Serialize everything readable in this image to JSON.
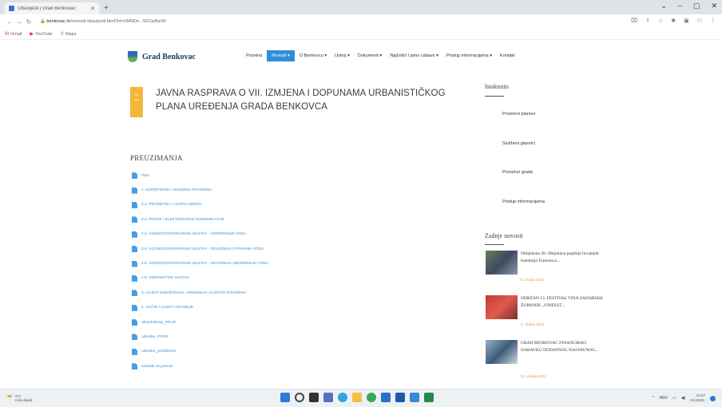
{
  "browser": {
    "tab_title": "Obavijesti | Grad Benkovac",
    "new_tab": "+",
    "win_min": "–",
    "win_max": "▢",
    "win_close": "✕",
    "url_domain": "benkovac.hr",
    "url_rest": "/novosti-obavijesti.html?id=UMNDe...SFCwBaXR",
    "bookmarks": [
      "Gmail",
      "YouTube",
      "Maps"
    ]
  },
  "site": {
    "logo": "Grad Benkovac",
    "nav": [
      {
        "label": "Početna",
        "active": false
      },
      {
        "label": "Novosti ▾",
        "active": true
      },
      {
        "label": "O Benkovcu ▾",
        "active": false
      },
      {
        "label": "Ustroj ▾",
        "active": false
      },
      {
        "label": "Dokumenti ▾",
        "active": false
      },
      {
        "label": "Najčešći i jamu cabavo ▾",
        "active": false
      },
      {
        "label": "Pristup informacijama ▾",
        "active": false
      },
      {
        "label": "Kontakt",
        "active": false
      }
    ]
  },
  "article": {
    "date_day": "0s",
    "date_month": "ozu",
    "title": "JAVNA RASPRAVA O VII. IZMJENA I DOPUNAMA URBANISTIČKOG PLANA UREĐENJA GRADA BENKOVCA"
  },
  "downloads": {
    "heading": "PREUZIMANJA",
    "items": [
      "Plan",
      "1. KORIŠTENJE I NAMJENA POVRŠINA",
      "2.1. PROMETNA I ULIČNA MREŽA",
      "2.2. POŠTE I ELEKTRONIČKE KOMUNIKACIJE",
      "2.3. VODNOGOSPODARSKI SUSTAV - KORIŠTENJE VODA",
      "2.4. VODNOGOSPODARSKI SUSTAV - ODVODNJA OTPADNIH VODA",
      "2.5. VODNOGOSPODARSKI SUSTAV - ODVODNJA OBORINSKIH VODA",
      "2.6. ENERGETSKI SUSTAV",
      "3. UVJETI KORIŠTENJA, UREĐENJA I ZAŠTITE POVRŠINA",
      "4. NAČIN I UVJETI GRADNJE",
      "obrazloženje_PPUR",
      "odredbe_PPUR",
      "odredbe_pročišćene",
      "sazetak za javnost"
    ]
  },
  "sidebar": {
    "featured_title": "Istaknuto",
    "links": [
      "Prostorni planovi",
      "Službeni glasnici",
      "Proračun grada",
      "Pristup informacijama"
    ],
    "news_title": "Zadnje novosti",
    "news": [
      {
        "title": "Obilježena 28. Obljetnica pogibije hrvatskih branitelja Tomislava...",
        "date": "9. ožujka 2022."
      },
      {
        "title": "ODRŽAN 13. FESTIVAL VINA ZADARSKE ŽUPANIJE „VINFEST...",
        "date": "5. ožujka 2022."
      },
      {
        "title": "GRAD BENKOVAC FINANCIRAO NABAVKU DODATNOG NASTAVNOG...",
        "date": "03. ožujka 2022."
      }
    ]
  },
  "taskbar": {
    "weather_temp": "9°C",
    "weather_text": "Kiša slijedi",
    "tray_lang": "HRV",
    "time": "14:47",
    "date": "9.3.2022."
  },
  "colors": {
    "nav_active": "#2f8fd6",
    "link": "#3b8ed0",
    "date_badge": "#f4b63a"
  }
}
